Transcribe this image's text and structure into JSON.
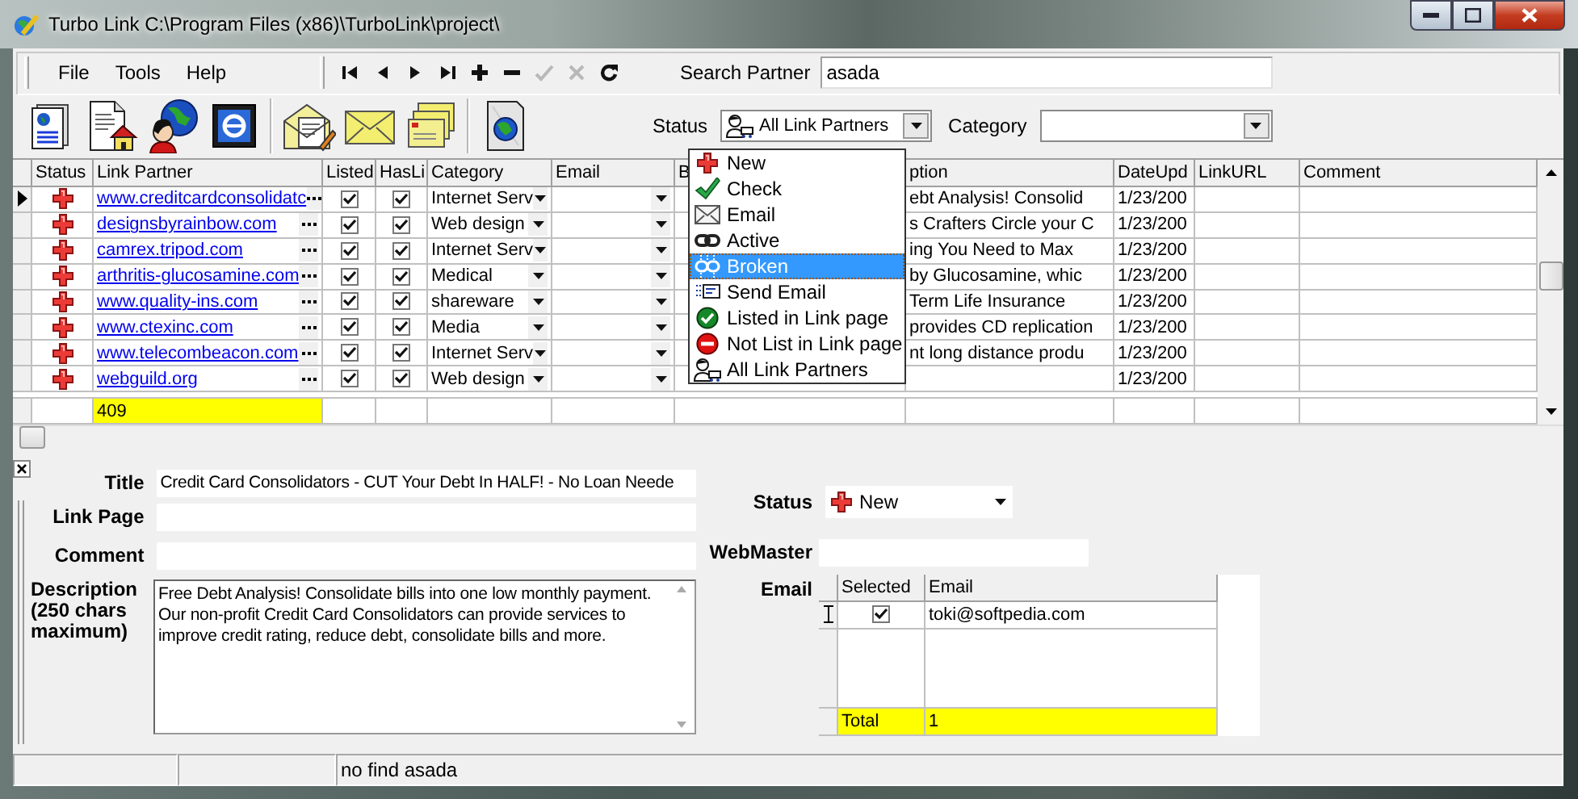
{
  "window": {
    "title": "Turbo Link C:\\Program Files (x86)\\TurboLink\\project\\"
  },
  "menu": [
    {
      "label": "File"
    },
    {
      "label": "Tools"
    },
    {
      "label": "Help"
    }
  ],
  "navigator": [
    {
      "kind": "first",
      "disabled": false
    },
    {
      "kind": "prior",
      "disabled": false
    },
    {
      "kind": "next",
      "disabled": false
    },
    {
      "kind": "last",
      "disabled": false
    },
    {
      "kind": "insert",
      "disabled": false
    },
    {
      "kind": "delete",
      "disabled": false
    },
    {
      "kind": "post",
      "disabled": true
    },
    {
      "kind": "cancel",
      "disabled": true
    },
    {
      "kind": "refresh",
      "disabled": false
    }
  ],
  "search": {
    "label": "Search Partner",
    "value": "asada"
  },
  "toolbar": [
    {
      "kind": "page-globe"
    },
    {
      "kind": "page-house"
    },
    {
      "kind": "person-globe"
    },
    {
      "kind": "browser-window"
    },
    {
      "kind": "envelope-letter"
    },
    {
      "kind": "envelope"
    },
    {
      "kind": "envelope-stack"
    },
    {
      "kind": "globe-page"
    }
  ],
  "filters": {
    "status_label": "Status",
    "status": {
      "kind": "all",
      "value": "All Link Partners"
    },
    "category_label": "Category"
  },
  "status_menu": [
    {
      "label": "New",
      "kind": "new",
      "selected": false
    },
    {
      "label": "Check",
      "kind": "check",
      "selected": false
    },
    {
      "label": "Email",
      "kind": "email",
      "selected": false
    },
    {
      "label": "Active",
      "kind": "active",
      "selected": false
    },
    {
      "label": "Broken",
      "kind": "broken",
      "selected": true
    },
    {
      "label": "Send Email",
      "kind": "send-email",
      "selected": false
    },
    {
      "label": "Listed in Link page",
      "kind": "listed",
      "selected": false
    },
    {
      "label": "Not List in Link page",
      "kind": "not-listed",
      "selected": false
    },
    {
      "label": "All Link Partners",
      "kind": "all",
      "selected": false
    }
  ],
  "grid": {
    "columns": [
      "Status",
      "Link Partner",
      "Listed",
      "HasLi",
      "Category",
      "Email",
      "B",
      "ption",
      "DateUpd",
      "LinkURL",
      "Comment"
    ],
    "rows": [
      {
        "current": true,
        "kind": "new",
        "partner": "www.creditcardconsolidatc",
        "listed": true,
        "has_link": true,
        "category": "Internet Serv",
        "description": "ebt Analysis! Consolid",
        "date": "1/23/200"
      },
      {
        "current": false,
        "kind": "new",
        "partner": "designsbyrainbow.com",
        "listed": true,
        "has_link": true,
        "category": "Web design",
        "description": "s Crafters Circle your C",
        "date": "1/23/200"
      },
      {
        "current": false,
        "kind": "new",
        "partner": "camrex.tripod.com",
        "listed": true,
        "has_link": true,
        "category": "Internet Serv",
        "description": "ing You Need to Max",
        "date": "1/23/200"
      },
      {
        "current": false,
        "kind": "new",
        "partner": "arthritis-glucosamine.com",
        "listed": true,
        "has_link": true,
        "category": "Medical",
        "description": "by Glucosamine, whic",
        "date": "1/23/200"
      },
      {
        "current": false,
        "kind": "new",
        "partner": "www.quality-ins.com",
        "listed": true,
        "has_link": true,
        "category": "shareware",
        "description": "Term Life Insurance",
        "date": "1/23/200"
      },
      {
        "current": false,
        "kind": "new",
        "partner": "www.ctexinc.com",
        "listed": true,
        "has_link": true,
        "category": "Media",
        "description": "provides CD replication",
        "date": "1/23/200"
      },
      {
        "current": false,
        "kind": "new",
        "partner": "www.telecombeacon.com",
        "listed": true,
        "has_link": true,
        "category": "Internet Serv",
        "description": "nt long distance produ",
        "date": "1/23/200"
      },
      {
        "current": false,
        "kind": "new",
        "partner": "webguild.org",
        "listed": true,
        "has_link": true,
        "category": "Web design",
        "date": "1/23/200"
      }
    ],
    "total": "409"
  },
  "detail": {
    "title_label": "Title",
    "title_value": "Credit Card Consolidators - CUT Your Debt In HALF! - No Loan Neede",
    "link_page_label": "Link Page",
    "comment_label": "Comment",
    "description_label": "Description (250 chars maximum)",
    "description_value": "Free Debt Analysis! Consolidate bills into one low monthly payment. Our non-profit Credit Card Consolidators can provide services to improve credit rating, reduce debt, consolidate bills and more.",
    "status_label": "Status",
    "status": {
      "kind": "new",
      "value": "New"
    },
    "webmaster_label": "WebMaster",
    "email_label": "Email",
    "email_grid": {
      "columns": [
        "Selected",
        "Email"
      ],
      "rows": [
        {
          "checked": true,
          "email": "toki@softpedia.com"
        }
      ],
      "total_label": "Total",
      "total_value": "1"
    }
  },
  "status_bar": {
    "message": "no find asada"
  }
}
